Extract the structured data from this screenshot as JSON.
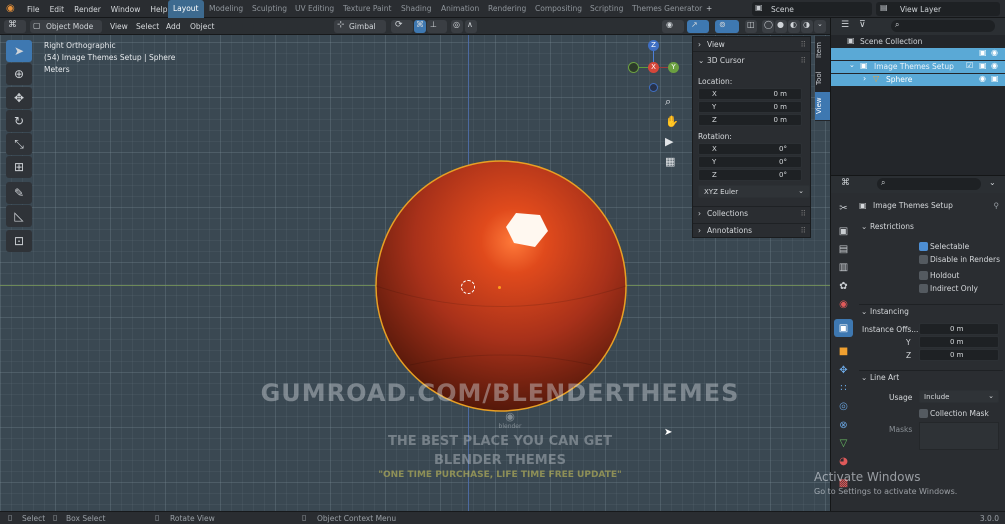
{
  "topbar": {
    "menus": [
      "File",
      "Edit",
      "Render",
      "Window",
      "Help"
    ],
    "workspaces": [
      "Layout",
      "Modeling",
      "Sculpting",
      "UV Editing",
      "Texture Paint",
      "Shading",
      "Animation",
      "Rendering",
      "Compositing",
      "Scripting",
      "Themes Generator"
    ],
    "add_tab": "+",
    "scene": "Scene",
    "view_layer": "View Layer"
  },
  "viewport_header": {
    "mode": "Object Mode",
    "menus": [
      "View",
      "Select",
      "Add",
      "Object"
    ],
    "orientation": "Gimbal"
  },
  "overlay": {
    "view_name": "Right Orthographic",
    "object_info": "(54) Image Themes Setup | Sphere",
    "units": "Meters"
  },
  "gizmo": {
    "z": "Z",
    "x": "X",
    "y": "Y"
  },
  "n_panel": {
    "view": "View",
    "cursor": "3D Cursor",
    "location": "Location:",
    "loc": [
      {
        "axis": "X",
        "value": "0 m"
      },
      {
        "axis": "Y",
        "value": "0 m"
      },
      {
        "axis": "Z",
        "value": "0 m"
      }
    ],
    "rotation": "Rotation:",
    "rot": [
      {
        "axis": "X",
        "value": "0°"
      },
      {
        "axis": "Y",
        "value": "0°"
      },
      {
        "axis": "Z",
        "value": "0°"
      }
    ],
    "rotation_mode": "XYZ Euler",
    "collections": "Collections",
    "annotations": "Annotations",
    "tabs": [
      "Item",
      "Tool",
      "View"
    ]
  },
  "watermark": {
    "url": "GUMROAD.COM/BLENDERTHEMES",
    "logo": "blender",
    "line1": "THE BEST PLACE YOU CAN GET",
    "line2": "BLENDER THEMES",
    "line3": "\"ONE TIME PURCHASE, LIFE TIME FREE UPDATE\""
  },
  "outliner": {
    "root": "Scene Collection",
    "collection": "Image Themes Setup",
    "object": "Sphere"
  },
  "properties": {
    "title": "Image Themes Setup",
    "restrictions": "Restrictions",
    "selectable": "Selectable",
    "disable_renders": "Disable in Renders",
    "holdout": "Holdout",
    "indirect_only": "Indirect Only",
    "instancing": "Instancing",
    "instance_offset": "Instance Offs...",
    "offset_y": "Y",
    "offset_z": "Z",
    "offset_values": [
      "0 m",
      "0 m",
      "0 m"
    ],
    "line_art": "Line Art",
    "usage_label": "Usage",
    "usage_value": "Include",
    "collection_mask": "Collection Mask",
    "masks": "Masks"
  },
  "activate": {
    "title": "Activate Windows",
    "subtitle": "Go to Settings to activate Windows."
  },
  "statusbar": {
    "select": "Select",
    "box_select": "Box Select",
    "rotate": "Rotate View",
    "context": "Object Context Menu",
    "version": "3.0.0"
  },
  "colors": {
    "accent": "#3e78b1",
    "sphere": "#a8311a",
    "outline": "#e8a024",
    "selected_row": "#5aa9d6"
  }
}
